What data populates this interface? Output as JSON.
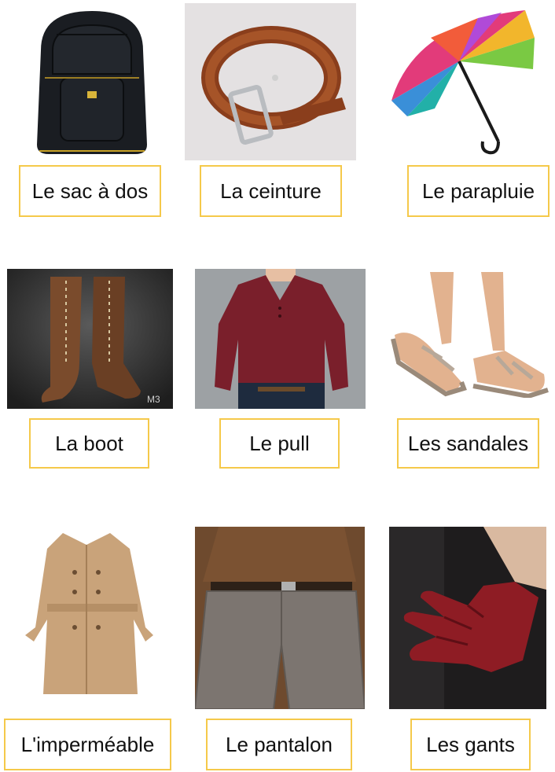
{
  "items": [
    {
      "label": "Le sac à dos"
    },
    {
      "label": "La ceinture"
    },
    {
      "label": "Le parapluie"
    },
    {
      "label": "La boot"
    },
    {
      "label": "Le pull"
    },
    {
      "label": "Les sandales"
    },
    {
      "label": "L'imperméable"
    },
    {
      "label": "Le pantalon"
    },
    {
      "label": "Les gants"
    }
  ],
  "watermark": "M3"
}
